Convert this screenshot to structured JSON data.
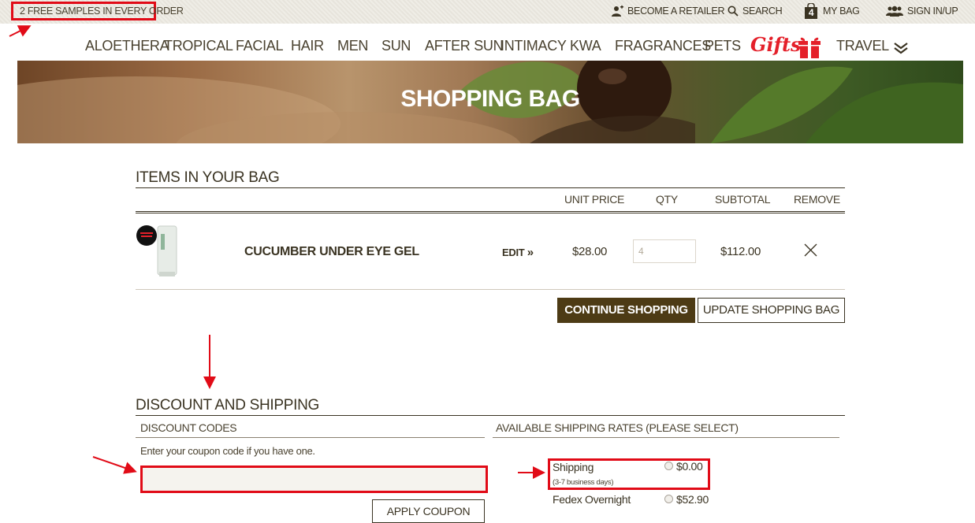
{
  "topbar": {
    "promo": "2 FREE SAMPLES IN EVERY ORDER",
    "retailer": "BECOME A RETAILER",
    "search": "SEARCH",
    "bag_count": "4",
    "bag": "MY BAG",
    "signin": "SIGN IN/UP"
  },
  "nav": {
    "items": [
      "ALOETHERA",
      "TROPICAL",
      "FACIAL",
      "HAIR",
      "MEN",
      "SUN",
      "AFTER SUN",
      "INTIMACY",
      "KWA",
      "FRAGRANCES",
      "PETS"
    ],
    "gifts": "Gifts",
    "travel": "TRAVEL"
  },
  "hero": {
    "title": "SHOPPING BAG"
  },
  "bag": {
    "heading": "ITEMS IN YOUR BAG",
    "columns": {
      "unit_price": "UNIT PRICE",
      "qty": "QTY",
      "subtotal": "SUBTOTAL",
      "remove": "REMOVE"
    },
    "items": [
      {
        "name": "CUCUMBER UNDER EYE GEL",
        "edit": "EDIT",
        "unit_price": "$28.00",
        "qty": "4",
        "subtotal": "$112.00"
      }
    ],
    "continue": "CONTINUE SHOPPING",
    "update": "UPDATE SHOPPING BAG"
  },
  "discount": {
    "heading": "DISCOUNT AND SHIPPING",
    "codes_heading": "DISCOUNT CODES",
    "hint": "Enter your coupon code if you have one.",
    "coupon_value": "",
    "apply": "APPLY COUPON"
  },
  "shipping": {
    "heading": "AVAILABLE SHIPPING RATES (PLEASE SELECT)",
    "options": [
      {
        "label": "Shipping",
        "note": "(3-7 business days)",
        "price": "$0.00"
      },
      {
        "label": "Fedex Overnight",
        "price": "$52.90"
      }
    ]
  },
  "colors": {
    "accent": "#e10b17",
    "button_dark": "#4d3b15",
    "text": "#3a3322"
  }
}
